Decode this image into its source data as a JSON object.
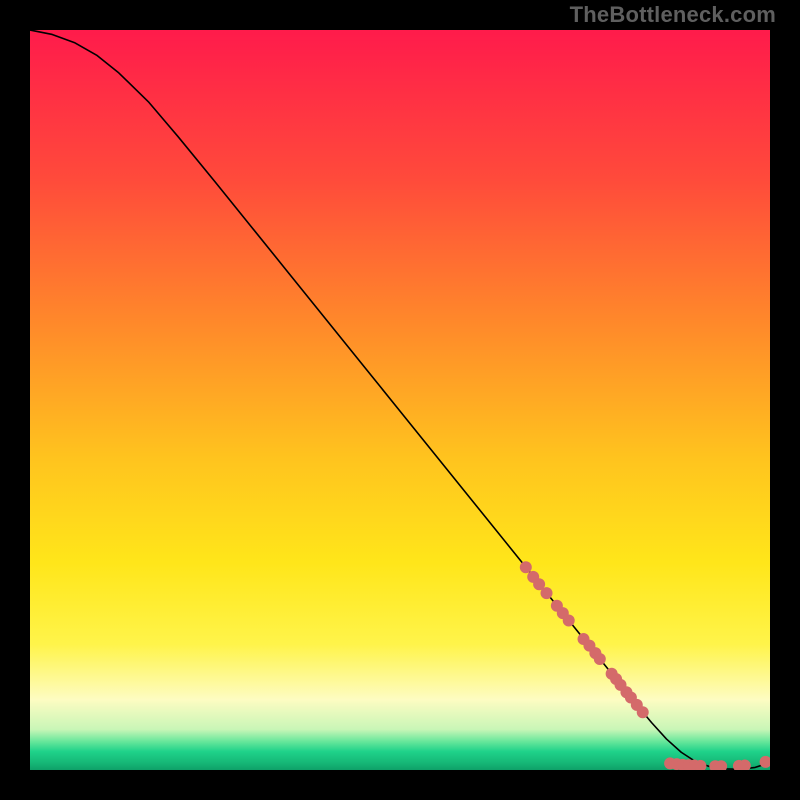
{
  "watermark": "TheBottleneck.com",
  "chart_data": {
    "type": "line",
    "title": "",
    "xlabel": "",
    "ylabel": "",
    "xlim": [
      0,
      100
    ],
    "ylim": [
      0,
      100
    ],
    "grid": false,
    "legend": false,
    "background_gradient_stops": [
      {
        "offset": 0.0,
        "color": "#ff1b4b"
      },
      {
        "offset": 0.2,
        "color": "#ff4a3b"
      },
      {
        "offset": 0.4,
        "color": "#ff8a2a"
      },
      {
        "offset": 0.58,
        "color": "#ffc41e"
      },
      {
        "offset": 0.72,
        "color": "#ffe61a"
      },
      {
        "offset": 0.83,
        "color": "#fff44a"
      },
      {
        "offset": 0.905,
        "color": "#fdfcc2"
      },
      {
        "offset": 0.945,
        "color": "#c9f6b7"
      },
      {
        "offset": 0.962,
        "color": "#64e69a"
      },
      {
        "offset": 0.975,
        "color": "#1fd28a"
      },
      {
        "offset": 0.99,
        "color": "#16b877"
      },
      {
        "offset": 1.0,
        "color": "#0fa068"
      }
    ],
    "series": [
      {
        "name": "bottleneck-curve",
        "stroke": "#000000",
        "stroke_width": 1.6,
        "x": [
          0,
          3,
          6,
          9,
          12,
          16,
          20,
          25,
          30,
          35,
          40,
          45,
          50,
          55,
          60,
          65,
          70,
          75,
          80,
          82,
          84,
          86,
          88,
          90,
          92,
          94,
          96,
          98,
          100
        ],
        "y": [
          100,
          99.4,
          98.3,
          96.6,
          94.2,
          90.3,
          85.6,
          79.5,
          73.3,
          67.1,
          60.9,
          54.7,
          48.5,
          42.3,
          36.1,
          29.9,
          23.7,
          17.5,
          11.3,
          8.8,
          6.4,
          4.2,
          2.4,
          1.1,
          0.4,
          0.15,
          0.1,
          0.35,
          1.0
        ]
      }
    ],
    "scatter": {
      "name": "highlight-points",
      "color": "#d46a6a",
      "radius": 6,
      "points": [
        {
          "x": 67.0,
          "y": 27.4
        },
        {
          "x": 68.0,
          "y": 26.1
        },
        {
          "x": 68.8,
          "y": 25.1
        },
        {
          "x": 69.8,
          "y": 23.9
        },
        {
          "x": 71.2,
          "y": 22.2
        },
        {
          "x": 72.0,
          "y": 21.2
        },
        {
          "x": 72.8,
          "y": 20.2
        },
        {
          "x": 74.8,
          "y": 17.7
        },
        {
          "x": 75.6,
          "y": 16.8
        },
        {
          "x": 76.4,
          "y": 15.8
        },
        {
          "x": 77.0,
          "y": 15.0
        },
        {
          "x": 78.6,
          "y": 13.0
        },
        {
          "x": 79.2,
          "y": 12.3
        },
        {
          "x": 79.8,
          "y": 11.5
        },
        {
          "x": 80.6,
          "y": 10.5
        },
        {
          "x": 81.2,
          "y": 9.8
        },
        {
          "x": 82.0,
          "y": 8.8
        },
        {
          "x": 82.8,
          "y": 7.8
        },
        {
          "x": 86.5,
          "y": 0.9
        },
        {
          "x": 87.4,
          "y": 0.8
        },
        {
          "x": 88.2,
          "y": 0.7
        },
        {
          "x": 89.0,
          "y": 0.65
        },
        {
          "x": 89.8,
          "y": 0.6
        },
        {
          "x": 90.6,
          "y": 0.55
        },
        {
          "x": 92.6,
          "y": 0.5
        },
        {
          "x": 93.4,
          "y": 0.5
        },
        {
          "x": 95.8,
          "y": 0.55
        },
        {
          "x": 96.6,
          "y": 0.6
        },
        {
          "x": 99.4,
          "y": 1.1
        }
      ]
    }
  }
}
